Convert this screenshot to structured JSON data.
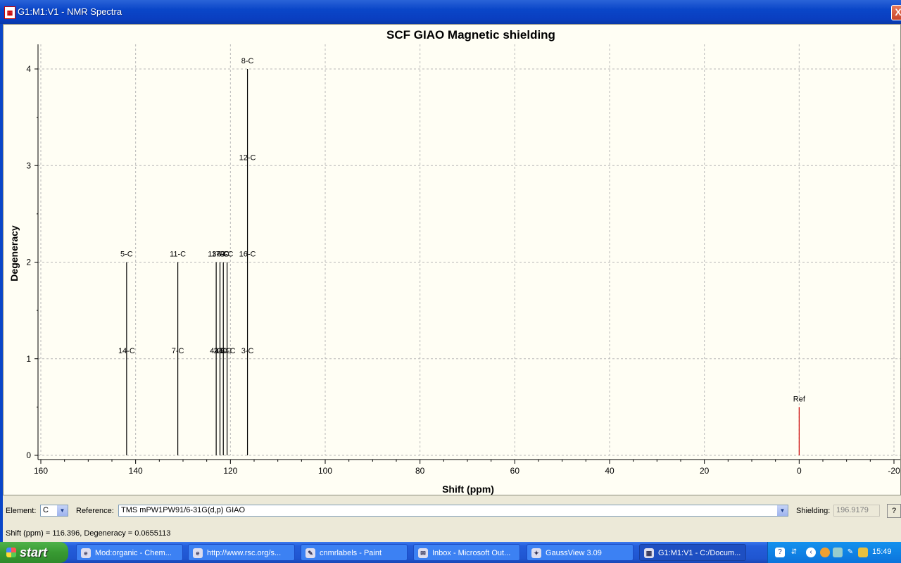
{
  "window": {
    "title": "G1:M1:V1 - NMR Spectra",
    "close_label": "X"
  },
  "chart_data": {
    "type": "stem",
    "title": "SCF GIAO Magnetic shielding",
    "xlabel": "Shift (ppm)",
    "ylabel": "Degeneracy",
    "xlim": [
      160,
      -20
    ],
    "ylim": [
      0,
      4.2
    ],
    "x_ticks": [
      160,
      140,
      120,
      100,
      80,
      60,
      40,
      20,
      0,
      -20
    ],
    "y_ticks": [
      0,
      1,
      2,
      3,
      4
    ],
    "grid": true,
    "peaks": [
      {
        "x": 141.9,
        "y": 2
      },
      {
        "x": 131.1,
        "y": 2
      },
      {
        "x": 123.0,
        "y": 2
      },
      {
        "x": 122.2,
        "y": 2
      },
      {
        "x": 121.5,
        "y": 2
      },
      {
        "x": 120.7,
        "y": 2
      },
      {
        "x": 116.4,
        "y": 4
      },
      {
        "x": 0.0,
        "y": 0.5,
        "color": "#cc0000"
      }
    ],
    "peak_labels": [
      {
        "text": "5-C",
        "x": 141.9,
        "y": 2
      },
      {
        "text": "14-C",
        "x": 141.9,
        "y": 1
      },
      {
        "text": "11-C",
        "x": 131.1,
        "y": 2
      },
      {
        "text": "7-C",
        "x": 131.1,
        "y": 1
      },
      {
        "text": "13-C",
        "x": 123.0,
        "y": 2
      },
      {
        "text": "17-C",
        "x": 122.2,
        "y": 2
      },
      {
        "text": "6-C",
        "x": 121.5,
        "y": 2
      },
      {
        "text": "9-C",
        "x": 120.7,
        "y": 2
      },
      {
        "text": "4-C",
        "x": 123.0,
        "y": 1
      },
      {
        "text": "2-C",
        "x": 122.2,
        "y": 1
      },
      {
        "text": "15-C",
        "x": 121.5,
        "y": 1
      },
      {
        "text": "10-C",
        "x": 120.7,
        "y": 1
      },
      {
        "text": "8-C",
        "x": 116.4,
        "y": 4
      },
      {
        "text": "12-C",
        "x": 116.4,
        "y": 3
      },
      {
        "text": "16-C",
        "x": 116.4,
        "y": 2
      },
      {
        "text": "3-C",
        "x": 116.4,
        "y": 1
      },
      {
        "text": "Ref",
        "x": 0.0,
        "y": 0.5
      }
    ]
  },
  "controls": {
    "element_label": "Element:",
    "element_value": "C",
    "reference_label": "Reference:",
    "reference_value": "TMS mPW1PW91/6-31G(d,p) GIAO",
    "shielding_label": "Shielding:",
    "shielding_value": "196.9179",
    "help_label": "?"
  },
  "status": {
    "text": "Shift (ppm) = 116.396,  Degeneracy = 0.0655113"
  },
  "taskbar": {
    "start_label": "start",
    "tasks": [
      {
        "label": "Mod:organic - Chem..."
      },
      {
        "label": "http://www.rsc.org/s..."
      },
      {
        "label": "cnmrlabels - Paint"
      },
      {
        "label": "Inbox - Microsoft Out..."
      },
      {
        "label": "GaussView 3.09"
      },
      {
        "label": "G1:M1:V1 - C:/Docum..."
      }
    ],
    "clock": "15:49"
  }
}
